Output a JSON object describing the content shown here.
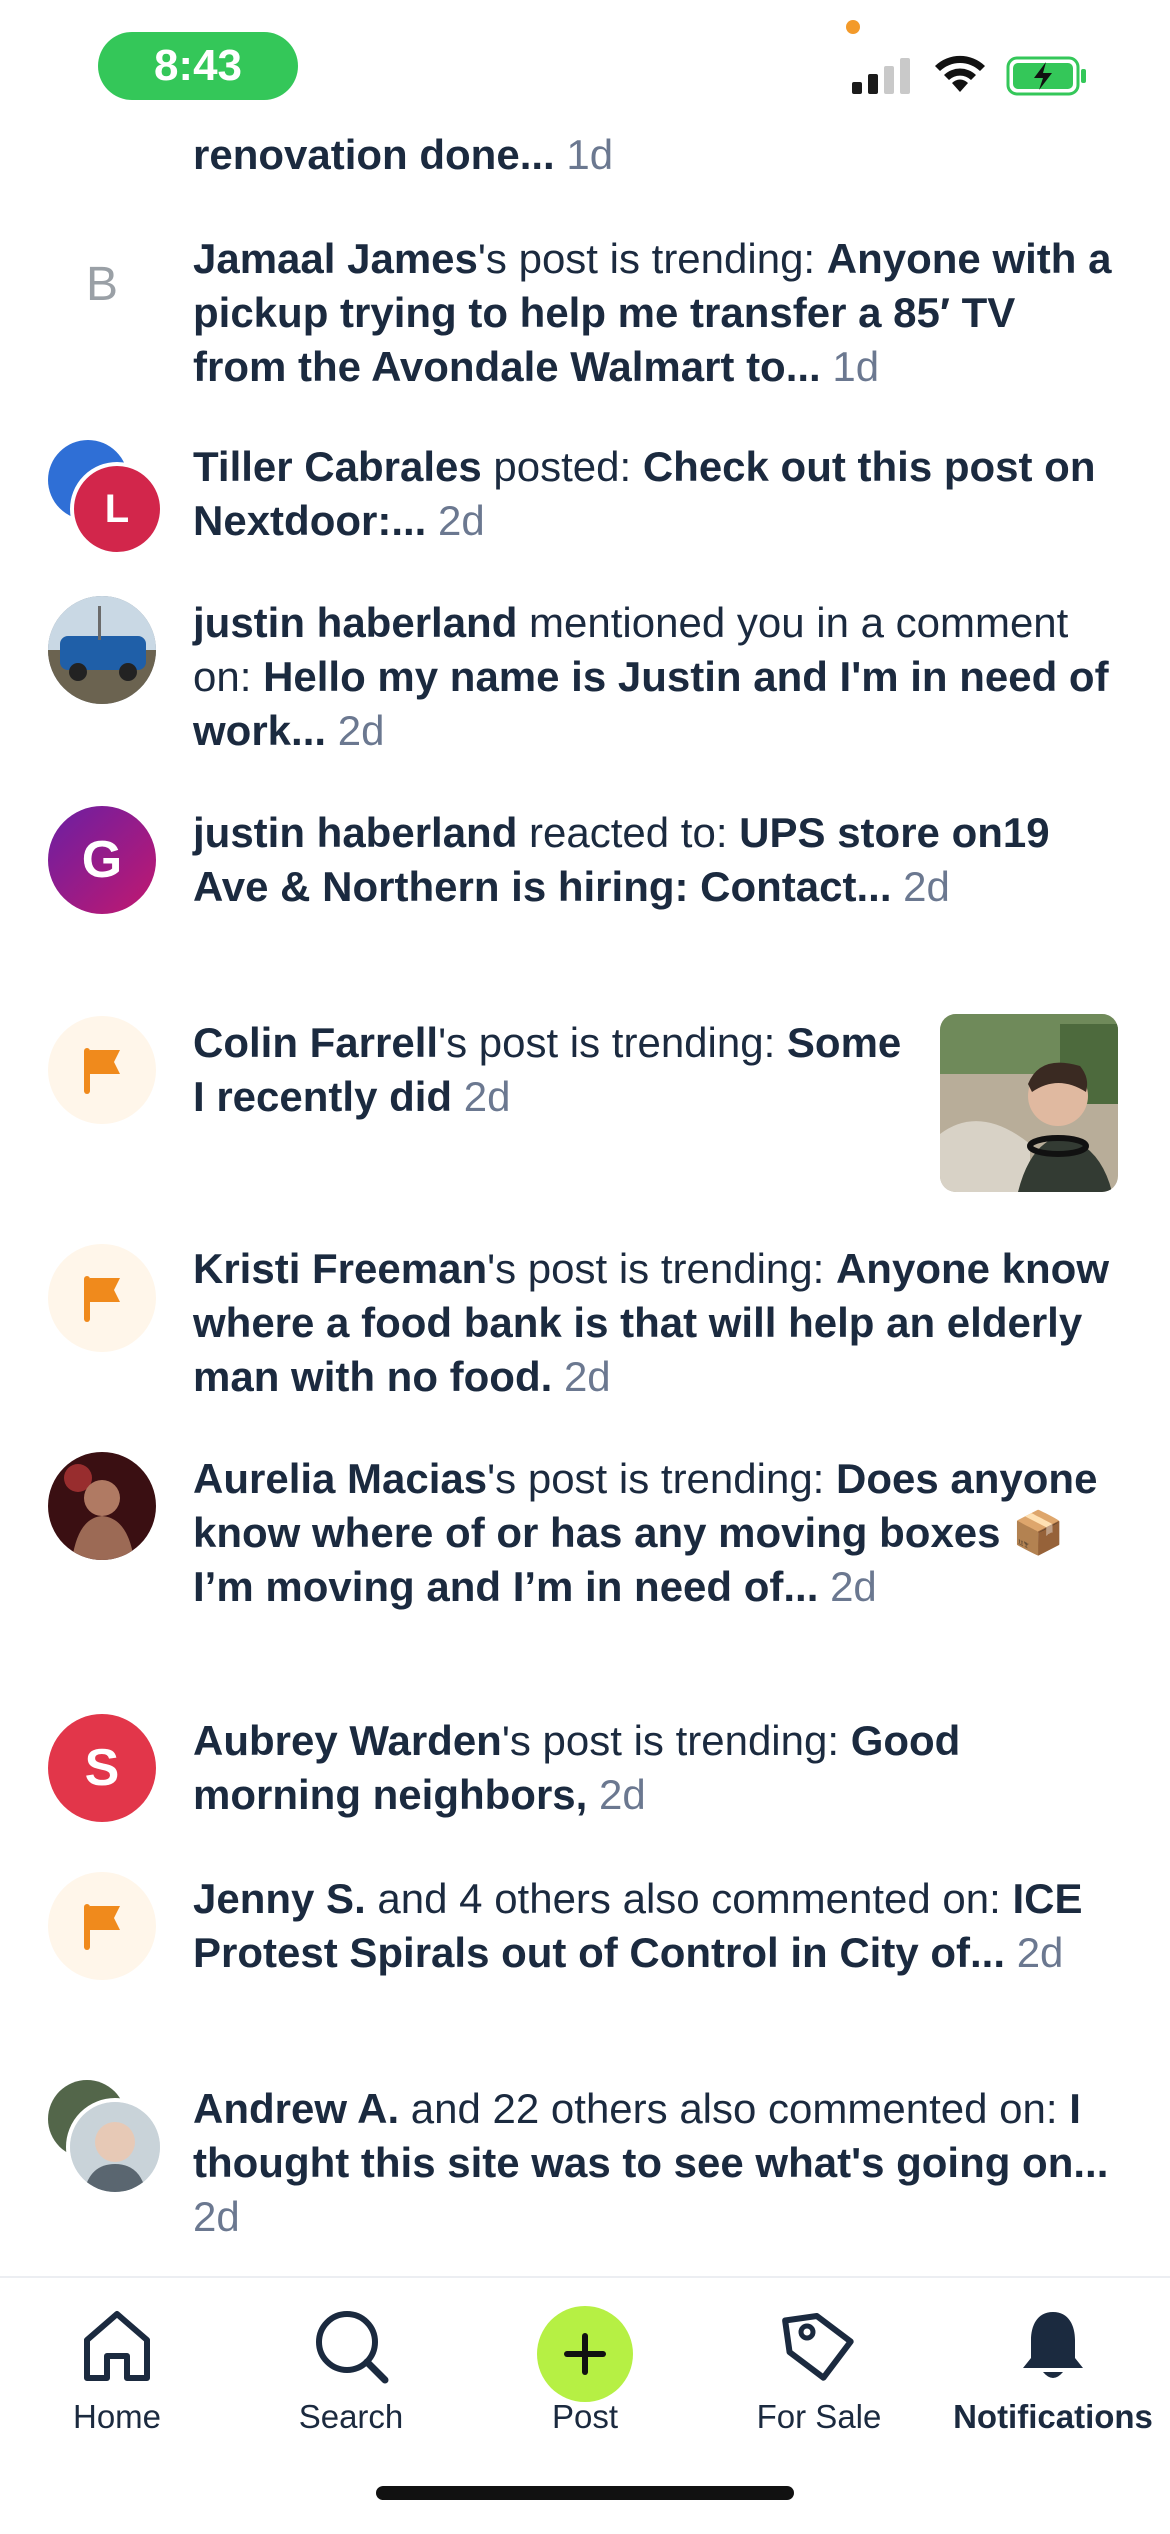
{
  "status": {
    "time": "8:43"
  },
  "notifications": [
    {
      "parts": [
        {
          "t": "renovation done...",
          "b": true
        }
      ],
      "age": "1d"
    },
    {
      "avatar_letter": "B",
      "parts": [
        {
          "t": "Jamaal James",
          "b": true
        },
        {
          "t": "'s post is trending: ",
          "b": false
        },
        {
          "t": "Anyone with a pickup trying to help me transfer a 85′ TV from the Avondale Walmart to...",
          "b": true
        }
      ],
      "age": "1d"
    },
    {
      "avatar_letter": "L",
      "parts": [
        {
          "t": "Tiller Cabrales",
          "b": true
        },
        {
          "t": " posted: ",
          "b": false
        },
        {
          "t": "Check out this post on Nextdoor:...",
          "b": true
        }
      ],
      "age": "2d"
    },
    {
      "parts": [
        {
          "t": "justin haberland",
          "b": true
        },
        {
          "t": " mentioned you in a comment on: ",
          "b": false
        },
        {
          "t": "Hello my name is Justin and I'm in need of work...",
          "b": true
        }
      ],
      "age": "2d"
    },
    {
      "avatar_letter": "G",
      "parts": [
        {
          "t": "justin haberland",
          "b": true
        },
        {
          "t": " reacted to: ",
          "b": false
        },
        {
          "t": "UPS store on19 Ave & Northern is hiring: Contact...",
          "b": true
        }
      ],
      "age": "2d"
    },
    {
      "parts": [
        {
          "t": "Colin Farrell",
          "b": true
        },
        {
          "t": "'s post is trending: ",
          "b": false
        },
        {
          "t": "Some I recently did",
          "b": true
        }
      ],
      "age": "2d"
    },
    {
      "parts": [
        {
          "t": "Kristi Freeman",
          "b": true
        },
        {
          "t": "'s post is trending: ",
          "b": false
        },
        {
          "t": "Anyone know where a food bank is that will help an elderly man with no food.",
          "b": true
        }
      ],
      "age": "2d"
    },
    {
      "parts": [
        {
          "t": "Aurelia Macias",
          "b": true
        },
        {
          "t": "'s post is trending: ",
          "b": false
        },
        {
          "t": "Does anyone know where of or has any moving boxes 📦 I’m  moving and I’m in need of...",
          "b": true
        }
      ],
      "age": "2d"
    },
    {
      "avatar_letter": "S",
      "parts": [
        {
          "t": "Aubrey Warden",
          "b": true
        },
        {
          "t": "'s post is trending: ",
          "b": false
        },
        {
          "t": "Good morning neighbors,",
          "b": true
        }
      ],
      "age": "2d"
    },
    {
      "parts": [
        {
          "t": "Jenny S.",
          "b": true
        },
        {
          "t": " and 4 others also commented on: ",
          "b": false
        },
        {
          "t": "ICE Protest Spirals out of Control in City of...",
          "b": true
        }
      ],
      "age": "2d"
    },
    {
      "parts": [
        {
          "t": "Andrew A.",
          "b": true
        },
        {
          "t": " and 22 others also commented on: ",
          "b": false
        },
        {
          "t": "I thought this site was to see what's going on...",
          "b": true
        }
      ],
      "age": "2d"
    }
  ],
  "nav": {
    "home": "Home",
    "search": "Search",
    "post": "Post",
    "for_sale": "For Sale",
    "notifications": "Notifications"
  },
  "colors": {
    "accent_green": "#b6f044",
    "flag_orange": "#f08a1c",
    "status_green": "#34c759"
  }
}
